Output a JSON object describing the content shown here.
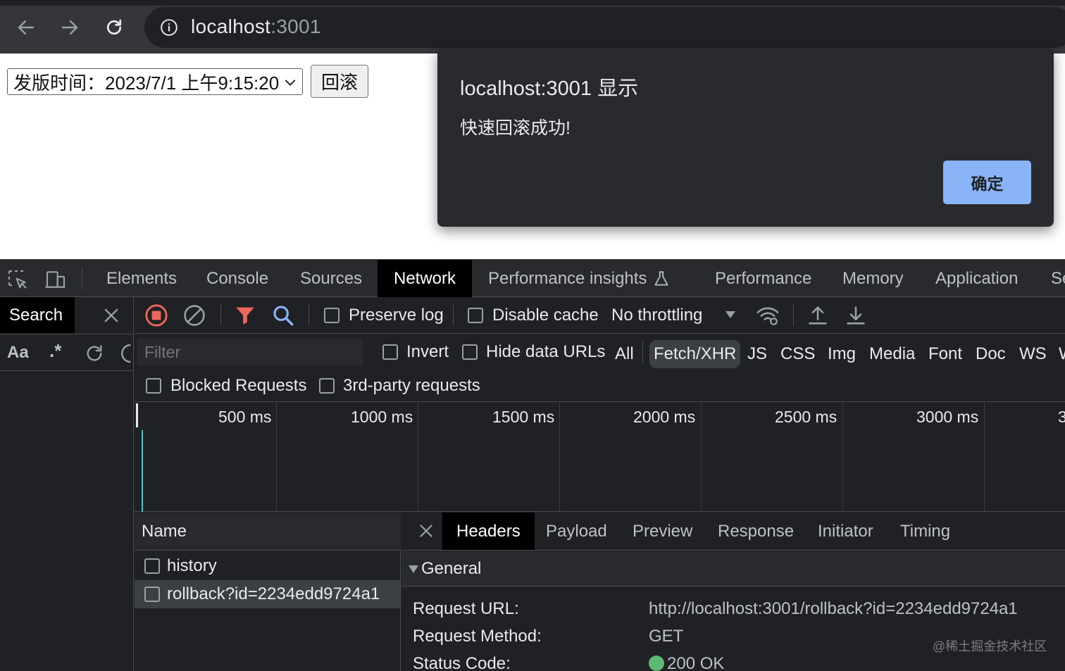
{
  "browser": {
    "url_host": "localhost",
    "url_port": ":3001"
  },
  "page": {
    "release_select_value": "发版时间：2023/7/1 上午9:15:20",
    "rollback_button": "回滚"
  },
  "alert": {
    "title": "localhost:3001 显示",
    "message": "快速回滚成功!",
    "ok_label": "确定",
    "accent": "#8ab4f8"
  },
  "devtools": {
    "tabs": [
      "Elements",
      "Console",
      "Sources",
      "Network",
      "Performance insights",
      "Performance",
      "Memory",
      "Application",
      "Se"
    ],
    "active_tab": "Network",
    "search_tab": "Search",
    "search_case_label": "Aa",
    "search_regex_label": ".*",
    "toolbar": {
      "preserve_log": "Preserve log",
      "disable_cache": "Disable cache",
      "throttling": "No throttling"
    },
    "filter": {
      "placeholder": "Filter",
      "invert": "Invert",
      "hide_data_urls": "Hide data URLs",
      "types": [
        "All",
        "Fetch/XHR",
        "JS",
        "CSS",
        "Img",
        "Media",
        "Font",
        "Doc",
        "WS",
        "W"
      ],
      "active_type": "Fetch/XHR",
      "blocked_requests": "Blocked Requests",
      "third_party": "3rd-party requests"
    },
    "overview_ticks": [
      "500 ms",
      "1000 ms",
      "1500 ms",
      "2000 ms",
      "2500 ms",
      "3000 ms",
      "3"
    ],
    "requests": {
      "header": "Name",
      "items": [
        "history",
        "rollback?id=2234edd9724a1"
      ],
      "selected_index": 1
    },
    "details": {
      "tabs": [
        "Headers",
        "Payload",
        "Preview",
        "Response",
        "Initiator",
        "Timing"
      ],
      "active_tab": "Headers",
      "section": "General",
      "rows": [
        {
          "key": "Request URL:",
          "value": "http://localhost:3001/rollback?id=2234edd9724a1"
        },
        {
          "key": "Request Method:",
          "value": "GET"
        },
        {
          "key": "Status Code:",
          "value": "200 OK"
        }
      ],
      "status_color": "#5bb974"
    }
  },
  "watermark": "@稀土掘金技术社区"
}
